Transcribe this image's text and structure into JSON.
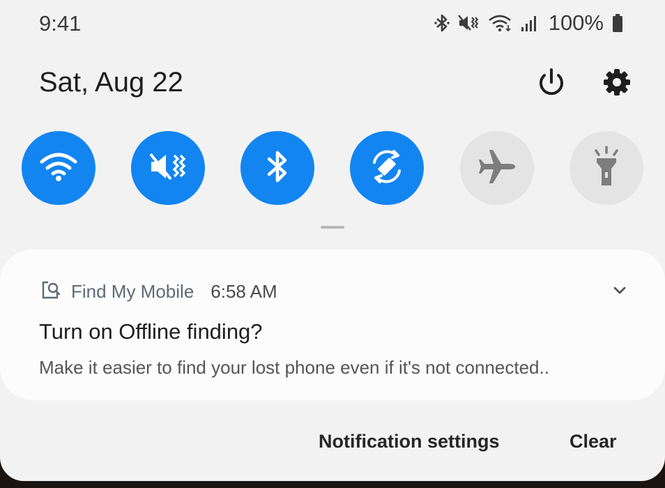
{
  "status_bar": {
    "time": "9:41",
    "battery": "100%",
    "icons": [
      "bluetooth-icon",
      "vibrate-icon",
      "wifi-icon",
      "signal-icon",
      "battery-icon"
    ]
  },
  "header": {
    "date": "Sat, Aug 22",
    "buttons": [
      "power-icon",
      "gear-icon"
    ]
  },
  "quick_settings": [
    {
      "name": "wifi",
      "icon": "wifi-icon",
      "active": true
    },
    {
      "name": "sound",
      "icon": "vibrate-icon",
      "active": true
    },
    {
      "name": "bluetooth",
      "icon": "bluetooth-icon",
      "active": true
    },
    {
      "name": "auto-rotate",
      "icon": "rotate-icon",
      "active": true
    },
    {
      "name": "airplane-mode",
      "icon": "airplane-icon",
      "active": false
    },
    {
      "name": "flashlight",
      "icon": "flashlight-icon",
      "active": false
    }
  ],
  "notification": {
    "app_name": "Find My Mobile",
    "time": "6:58 AM",
    "title": "Turn on Offline finding?",
    "body": "Make it easier to find your lost phone even if it's not connected.."
  },
  "footer": {
    "settings_label": "Notification settings",
    "clear_label": "Clear"
  },
  "colors": {
    "accent": "#1285f1",
    "tile_off": "#e4e4e4",
    "background": "#f2f2f2",
    "card": "#fcfcfc"
  }
}
